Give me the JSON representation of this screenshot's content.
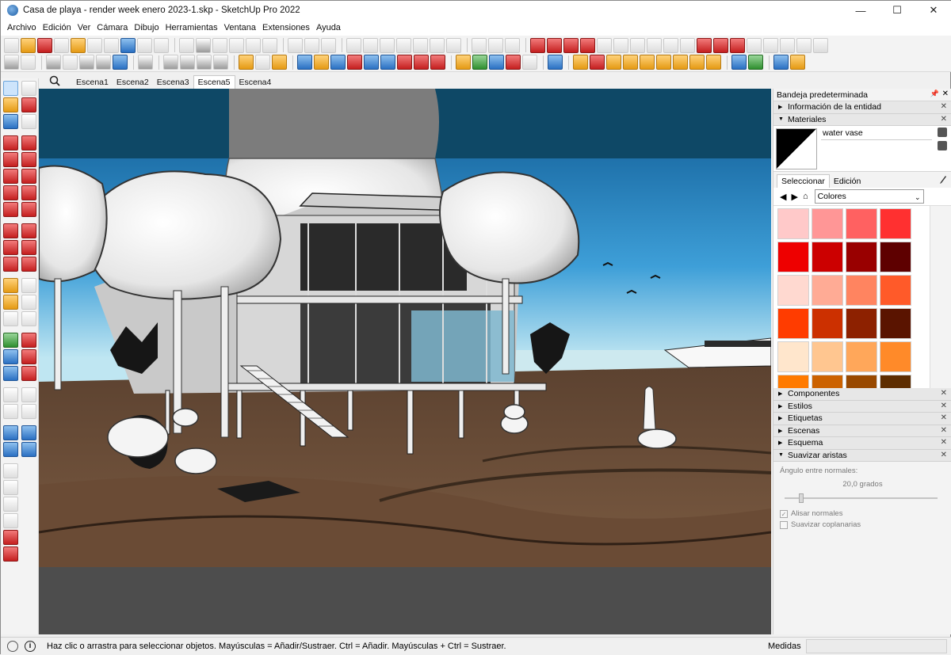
{
  "window": {
    "title": "Casa de playa - render week enero 2023-1.skp - SketchUp Pro 2022",
    "controls": [
      "—",
      "☐",
      "✕"
    ]
  },
  "menu": [
    "Archivo",
    "Edición",
    "Ver",
    "Cámara",
    "Dibujo",
    "Herramientas",
    "Ventana",
    "Extensiones",
    "Ayuda"
  ],
  "scenes": {
    "tabs": [
      "Escena1",
      "Escena2",
      "Escena3",
      "Escena5",
      "Escena4"
    ],
    "active_index": 3
  },
  "tray": {
    "title": "Bandeja predeterminada",
    "entity_info": "Información de la entidad",
    "materials": {
      "header": "Materiales",
      "current_name": "water vase",
      "tab_select": "Seleccionar",
      "tab_edit": "Edición",
      "collection": "Colores",
      "swatches": [
        "#ffc9c9",
        "#ff9696",
        "#ff6161",
        "#ff3030",
        "#ee0000",
        "#cc0000",
        "#990000",
        "#5e0000",
        "#ffd9d0",
        "#ffab95",
        "#ff8460",
        "#ff5a29",
        "#ff3c00",
        "#cc3000",
        "#8d2100",
        "#5a1400",
        "#ffe6cc",
        "#ffc690",
        "#ffa75a",
        "#ff8a29",
        "#ff7a00",
        "#cc6200",
        "#994900",
        "#5e2d00"
      ]
    },
    "panels": [
      "Componentes",
      "Estilos",
      "Etiquetas",
      "Escenas",
      "Esquema"
    ],
    "soften": {
      "header": "Suavizar aristas",
      "angle_label": "Ángulo entre normales:",
      "angle_value": "20,0",
      "angle_unit": "grados",
      "smooth_normals": "Alisar normales",
      "soften_coplanar": "Suavizar coplanarias"
    }
  },
  "status": {
    "message": "Haz clic o arrastra para seleccionar objetos. Mayúsculas = Añadir/Sustraer. Ctrl = Añadir. Mayúsculas + Ctrl = Sustraer.",
    "measurements_label": "Medidas",
    "measurements_value": ""
  },
  "colors": {
    "sky_top": "#0e4866",
    "sky_mid": "#2b8cc9",
    "sky_bottom": "#bfe6f2",
    "sea": "#cde9ef",
    "sand": "#6b4c35",
    "ground_shadow": "#4a4a4a"
  }
}
